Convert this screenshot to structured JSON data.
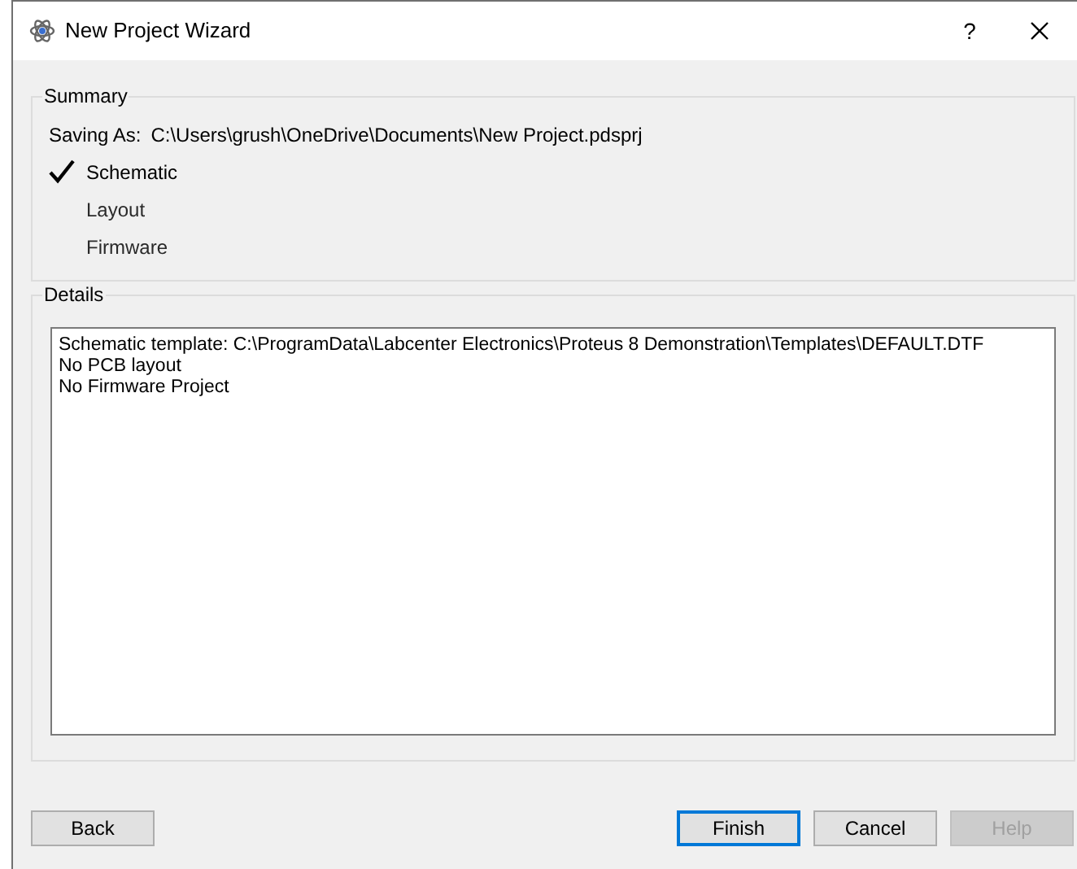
{
  "window": {
    "title": "New Project Wizard",
    "help_glyph": "?"
  },
  "summary": {
    "title": "Summary",
    "saving_as_label": "Saving As:",
    "saving_as_path": "C:\\Users\\grush\\OneDrive\\Documents\\New Project.pdsprj",
    "items": [
      {
        "label": "Schematic",
        "checked": true
      },
      {
        "label": "Layout",
        "checked": false
      },
      {
        "label": "Firmware",
        "checked": false
      }
    ]
  },
  "details": {
    "title": "Details",
    "lines": [
      "Schematic template: C:\\ProgramData\\Labcenter Electronics\\Proteus 8 Demonstration\\Templates\\DEFAULT.DTF",
      "No PCB layout",
      "No Firmware Project"
    ]
  },
  "buttons": [
    {
      "label": "Back",
      "default": false,
      "disabled": false
    },
    {
      "label": "Finish",
      "default": true,
      "disabled": false
    },
    {
      "label": "Cancel",
      "default": false,
      "disabled": false
    },
    {
      "label": "Help",
      "default": false,
      "disabled": true
    }
  ]
}
